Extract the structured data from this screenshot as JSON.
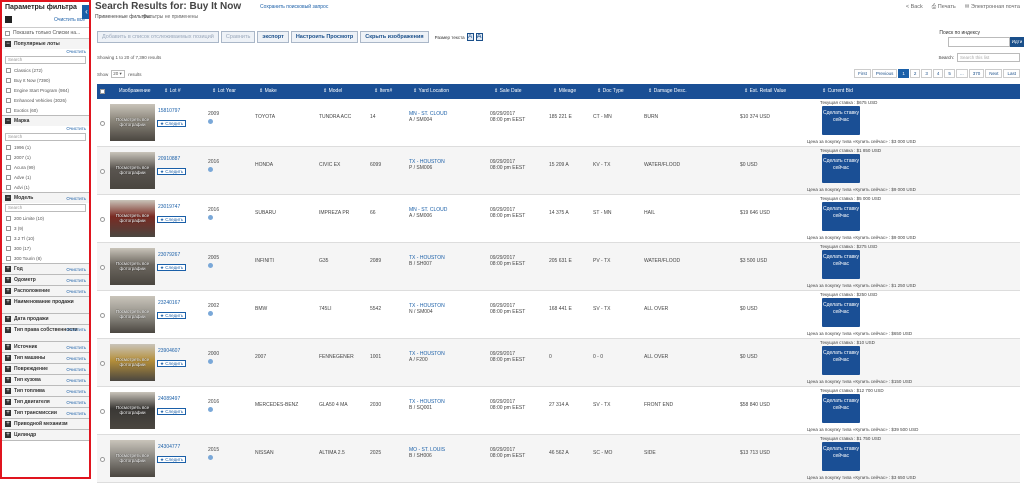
{
  "sidebar": {
    "title": "Параметры фильтра",
    "clear_all": "Очистить все",
    "collapse_arrow": "‹",
    "show_only_label": "Показать только Списки на...",
    "sections": [
      {
        "id": "popular",
        "label": "Популярные лоты",
        "open": true,
        "clear": "Очистить",
        "search": "Search",
        "options": [
          "Classics (272)",
          "Buy It Now (7390)",
          "Engine Start Program (984)",
          "Enhanced Vehicles (3026)",
          "Exotics (60)"
        ]
      },
      {
        "id": "make",
        "label": "Марка",
        "open": true,
        "clear": "Очистить",
        "search": "Search",
        "options": [
          "1996 (1)",
          "2007 (1)",
          "Acura (99)",
          "Adve (1)",
          "Advi (1)"
        ]
      },
      {
        "id": "model",
        "label": "Модель",
        "open": true,
        "clear": "Очистить",
        "search": "Search",
        "options": [
          "200 Limite (10)",
          "3 (9)",
          "3.2 Tl (10)",
          "300 (17)",
          "300 Tourin (8)"
        ]
      }
    ],
    "collapsed_sections": [
      {
        "label": "Год",
        "clear": "Очистить"
      },
      {
        "label": "Одометр",
        "clear": "Очистить"
      },
      {
        "label": "Расположение",
        "clear": "Очистить"
      },
      {
        "label": "Наименование продажи",
        "clear": ""
      },
      {
        "label": "Дата продажи",
        "clear": ""
      },
      {
        "label": "Тип права собственности",
        "clear": "Очистить"
      },
      {
        "label": "Источник",
        "clear": "Очистить"
      },
      {
        "label": "Тип машины",
        "clear": "Очистить"
      },
      {
        "label": "Повреждение",
        "clear": "Очистить"
      },
      {
        "label": "Тип кузова",
        "clear": "Очистить"
      },
      {
        "label": "Тип топлива",
        "clear": "Очистить"
      },
      {
        "label": "Тип двигателя",
        "clear": "Очистить"
      },
      {
        "label": "Тип трансмиссии",
        "clear": "Очистить"
      },
      {
        "label": "Приводной механизм",
        "clear": ""
      },
      {
        "label": "Цилиндр",
        "clear": ""
      }
    ]
  },
  "header": {
    "title": "Search Results for: Buy It Now",
    "save_search": "Сохранить поисковый запрос",
    "applied_label": "Примененные фильтры:",
    "applied_value": "Фильтры не применены",
    "back": "< Back",
    "print": "Печать",
    "email": "Электронная почта"
  },
  "toolbar": {
    "add_watchlist": "Добавить в список отслеживаемых позиций",
    "compare": "Сравнить",
    "export": "экспорт",
    "customize": "Настроить Просмотр",
    "hide_images": "Скрыть изображения",
    "text_size": "Размер текста",
    "text_small": "A",
    "text_large": "A",
    "lot_search_label": "Поиск по индексу",
    "lot_go": "Идти"
  },
  "results": {
    "showing": "Showing 1 to 20 of 7,390 results",
    "search_label": "Search:",
    "search_placeholder": "Search this list",
    "show_label": "Show",
    "show_value": "20",
    "results_label": "results",
    "pager": [
      "First",
      "Previous",
      "1",
      "2",
      "3",
      "4",
      "5",
      "...",
      "370",
      "Next",
      "Last"
    ],
    "pager_active": "1"
  },
  "columns": [
    "Изображение",
    "Lot #",
    "Lot Year",
    "Make",
    "Model",
    "Item#",
    "Yard Location",
    "Sale Date",
    "Mileage",
    "Doc Type",
    "Damage Desc.",
    "Est. Retail Value",
    "Current Bid"
  ],
  "row_texts": {
    "photo_caption": "Посмотреть все фотографии",
    "follow": "Следить",
    "bid_button": "Сделать ставку сейчас"
  },
  "rows": [
    {
      "lot": "15810797",
      "year": "2009",
      "make": "TOYOTA",
      "model": "TUNDRA ACC",
      "item": "14",
      "yard1": "MN - ST. CLOUD",
      "yard2": "A / SM004",
      "date1": "09/29/2017",
      "date2": "08:00 pm EEST",
      "mileage": "185 221 E",
      "doc": "CT - MN",
      "damage": "BURN",
      "retail": "$10 374 USD",
      "current": "Текущая ставка : $675 USD",
      "buy": "Цена за покупку типа «Купить сейчас» : $3 000 USD",
      "photo": "#8a857a"
    },
    {
      "lot": "20910887",
      "year": "2016",
      "make": "HONDA",
      "model": "CIVIC EX",
      "item": "6099",
      "yard1": "TX - HOUSTON",
      "yard2": "P / SM006",
      "date1": "09/29/2017",
      "date2": "08:00 pm EEST",
      "mileage": "15 209 A",
      "doc": "KV - TX",
      "damage": "WATER/FLOOD",
      "retail": "$0 USD",
      "current": "Текущая ставка : $1 850 USD",
      "buy": "Цена за покупку типа «Купить сейчас» : $9 000 USD",
      "photo": "#5a5550"
    },
    {
      "lot": "23019747",
      "year": "2016",
      "make": "SUBARU",
      "model": "IMPREZA PR",
      "item": "66",
      "yard1": "MN - ST. CLOUD",
      "yard2": "A / SM006",
      "date1": "09/29/2017",
      "date2": "08:00 pm EEST",
      "mileage": "14 375 A",
      "doc": "ST - MN",
      "damage": "HAIL",
      "retail": "$19 646 USD",
      "current": "Текущая ставка : $5 000 USD",
      "buy": "Цена за покупку типа «Купить сейчас» : $9 000 USD",
      "photo": "#7a2a22"
    },
    {
      "lot": "23079267",
      "year": "2005",
      "make": "INFINITI",
      "model": "G35",
      "item": "2089",
      "yard1": "TX - HOUSTON",
      "yard2": "B / SH007",
      "date1": "09/29/2017",
      "date2": "08:00 pm EEST",
      "mileage": "205 631 E",
      "doc": "PV - TX",
      "damage": "WATER/FLOOD",
      "retail": "$3 500 USD",
      "current": "Текущая ставка : $275 USD",
      "buy": "Цена за покупку типа «Купить сейчас» : $1 250 USD",
      "photo": "#6d6860"
    },
    {
      "lot": "23240167",
      "year": "2002",
      "make": "BMW",
      "model": "745LI",
      "item": "5542",
      "yard1": "TX - HOUSTON",
      "yard2": "N / SM004",
      "date1": "09/29/2017",
      "date2": "08:00 pm EEST",
      "mileage": "168 441 E",
      "doc": "SV - TX",
      "damage": "ALL OVER",
      "retail": "$0 USD",
      "current": "Текущая ставка : $250 USD",
      "buy": "Цена за покупку типа «Купить сейчас» : $650 USD",
      "photo": "#9a978f"
    },
    {
      "lot": "23904607",
      "year": "2000",
      "make": "2007",
      "model": "FENNEGENER",
      "item": "1001",
      "yard1": "TX - HOUSTON",
      "yard2": "A / F200",
      "date1": "09/29/2017",
      "date2": "08:00 pm EEST",
      "mileage": "0",
      "doc": "0 - 0",
      "damage": "ALL OVER",
      "retail": "$0 USD",
      "current": "Текущая ставка : $10 USD",
      "buy": "Цена за покупку типа «Купить сейчас» : $150 USD",
      "photo": "#b58f3a"
    },
    {
      "lot": "24089497",
      "year": "2016",
      "make": "MERCEDES-BENZ",
      "model": "GLA50 4 MA",
      "item": "2030",
      "yard1": "TX - HOUSTON",
      "yard2": "B / SQ001",
      "date1": "09/29/2017",
      "date2": "08:00 pm EEST",
      "mileage": "27 314 A",
      "doc": "SV - TX",
      "damage": "FRONT END",
      "retail": "$58 840 USD",
      "current": "Текущая ставка : $12 700 USD",
      "buy": "Цена за покупку типа «Купить сейчас» : $39 500 USD",
      "photo": "#3a3835"
    },
    {
      "lot": "24304777",
      "year": "2015",
      "make": "NISSAN",
      "model": "ALTIMA 2.5",
      "item": "2025",
      "yard1": "MO - ST. LOUIS",
      "yard2": "B / SH006",
      "date1": "09/29/2017",
      "date2": "08:00 pm EEST",
      "mileage": "46 562 A",
      "doc": "SC - MO",
      "damage": "SIDE",
      "retail": "$13 713 USD",
      "current": "Текущая ставка : $1 750 USD",
      "buy": "Цена за покупку типа «Купить сейчас» : $3 650 USD",
      "photo": "#8d8a84"
    }
  ]
}
